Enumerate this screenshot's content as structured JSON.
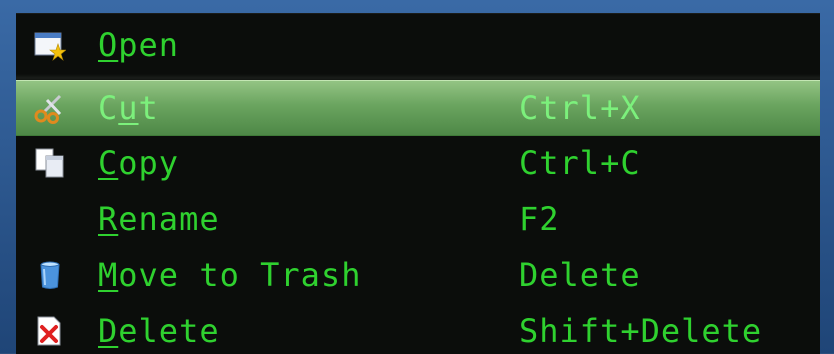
{
  "menu": {
    "items": [
      {
        "pre": "",
        "mn": "O",
        "post": "pen",
        "accel": "",
        "icon": "open-window-icon"
      },
      {
        "pre": "C",
        "mn": "u",
        "post": "t",
        "accel": "Ctrl+X",
        "icon": "scissors-icon",
        "highlighted": true
      },
      {
        "pre": "",
        "mn": "C",
        "post": "opy",
        "accel": "Ctrl+C",
        "icon": "copy-documents-icon"
      },
      {
        "pre": "",
        "mn": "R",
        "post": "ename",
        "accel": "F2",
        "icon": ""
      },
      {
        "pre": "",
        "mn": "M",
        "post": "ove to Trash",
        "accel": "Delete",
        "icon": "trash-can-icon"
      },
      {
        "pre": "",
        "mn": "D",
        "post": "elete",
        "accel": "Shift+Delete",
        "icon": "delete-red-x-icon"
      }
    ]
  },
  "colors": {
    "text": "#2fd12f",
    "highlight_text": "#7cf07c",
    "menu_background": "#0b0d0b",
    "highlight_background": "#6aa45f",
    "frame": "#2d4f7c"
  }
}
